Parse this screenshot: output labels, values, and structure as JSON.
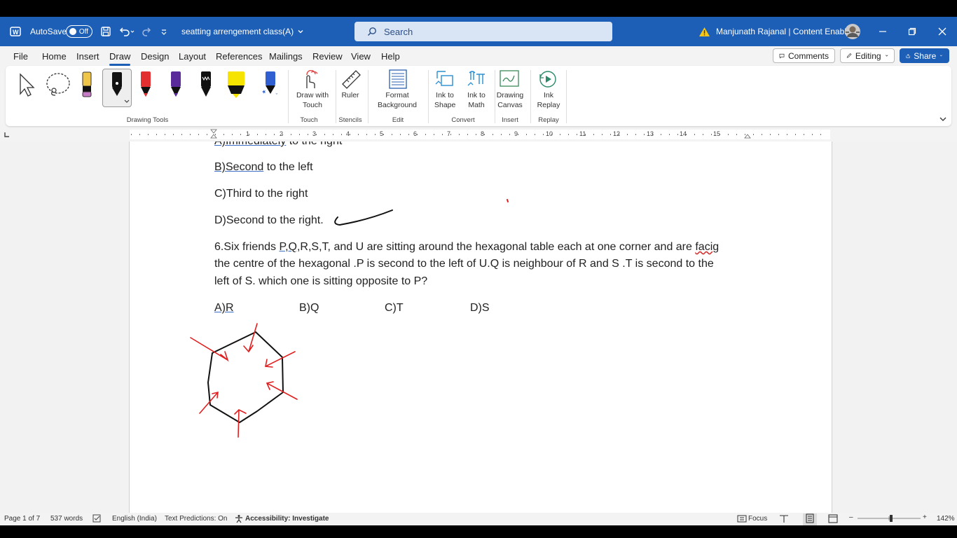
{
  "titlebar": {
    "autosave_label": "AutoSave",
    "autosave_state": "Off",
    "doc_title": "seatting arrengement class(A)",
    "search_placeholder": "Search",
    "user_name": "Manjunath Rajanal | Content Enablers"
  },
  "menu": {
    "items": [
      "File",
      "Home",
      "Insert",
      "Draw",
      "Design",
      "Layout",
      "References",
      "Mailings",
      "Review",
      "View",
      "Help"
    ],
    "active": "Draw",
    "comments_label": "Comments",
    "editing_label": "Editing",
    "share_label": "Share"
  },
  "ribbon": {
    "groups": {
      "drawing_tools": "Drawing Tools",
      "touch": "Touch",
      "stencils": "Stencils",
      "edit": "Edit",
      "convert": "Convert",
      "insert": "Insert",
      "replay": "Replay"
    },
    "buttons": {
      "draw_with_touch_1": "Draw with",
      "draw_with_touch_2": "Touch",
      "ruler": "Ruler",
      "format_bg_1": "Format",
      "format_bg_2": "Background",
      "ink_shape_1": "Ink to",
      "ink_shape_2": "Shape",
      "ink_math_1": "Ink to",
      "ink_math_2": "Math",
      "drawing_canvas_1": "Drawing",
      "drawing_canvas_2": "Canvas",
      "ink_replay_1": "Ink",
      "ink_replay_2": "Replay"
    },
    "pen_colors": [
      "#f0c64a",
      "#111111",
      "#e23030",
      "#5b2a9a",
      "#111111",
      "#f7e300",
      "#2f5fd0"
    ]
  },
  "ruler": {
    "numbers": [
      "1",
      "2",
      "3",
      "4",
      "5",
      "6",
      "7",
      "8",
      "9",
      "10",
      "11",
      "12",
      "13",
      "14",
      "15"
    ]
  },
  "document": {
    "line_top_prefix": "A)Immediately",
    "line_top_suffix": " to the right",
    "option_b_word": "B)Second",
    "option_b_rest": " to the left",
    "option_c": "C)Third to the right",
    "option_d": "D)Second to the right.",
    "q6_line1_a": "6.Six friends ",
    "q6_line1_b": "P,Q",
    "q6_line1_c": ",R,S,T, and U are sitting around the hexagonal table each at one corner and are ",
    "q6_line1_d": "facig",
    "q6_line2": "the centre of the hexagonal .P is second to the left of U.Q is neighbour of R and S .T is second to the",
    "q6_line3": "left of S. which one is sitting opposite to P?",
    "answers": [
      "A)R",
      "B)Q",
      "C)T",
      "D)S"
    ]
  },
  "statusbar": {
    "page": "Page 1 of 7",
    "words": "537 words",
    "language": "English (India)",
    "predictions": "Text Predictions: On",
    "accessibility": "Accessibility: Investigate",
    "focus": "Focus",
    "zoom": "142%"
  }
}
